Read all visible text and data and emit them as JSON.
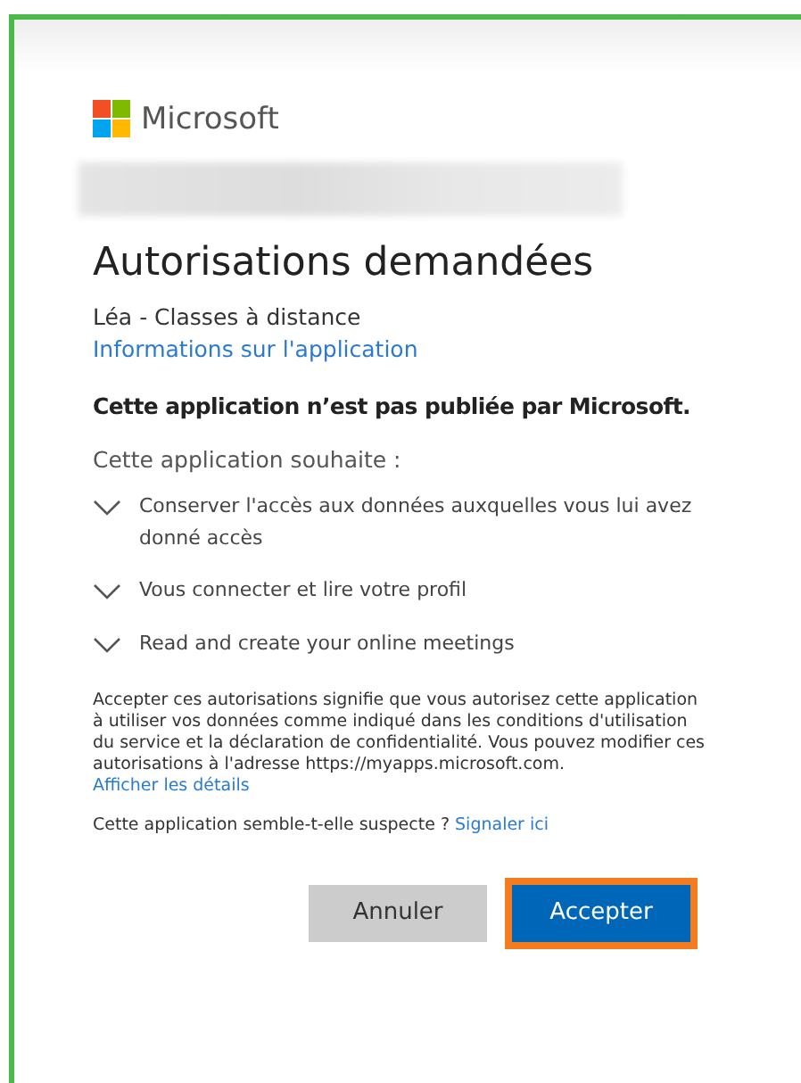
{
  "brand": {
    "name": "Microsoft"
  },
  "title": "Autorisations demandées",
  "app_name": "Léa - Classes à distance",
  "app_info_link": "Informations sur l'application",
  "warning": "Cette application n’est pas publiée par Microsoft.",
  "intro": "Cette application souhaite :",
  "permissions": [
    {
      "label": "Conserver l'accès aux données auxquelles vous lui avez donné accès",
      "expanded": false
    },
    {
      "label": "Vous connecter et lire votre profil",
      "expanded": false
    },
    {
      "label": "Read and create your online meetings",
      "expanded": false
    }
  ],
  "consent": {
    "text": "Accepter ces autorisations signifie que vous autorisez cette application à utiliser vos données comme indiqué dans les conditions d'utilisation du service et la déclaration de confidentialité. Vous pouvez modifier ces autorisations à l'adresse https://myapps.microsoft.com.",
    "link": "Afficher les détails"
  },
  "report": {
    "text": "Cette application semble-t-elle suspecte ?",
    "link": "Signaler ici"
  },
  "buttons": [
    {
      "label": "Annuler",
      "kind": "secondary",
      "highlighted": false
    },
    {
      "label": "Accepter",
      "kind": "primary",
      "highlighted": true
    }
  ]
}
